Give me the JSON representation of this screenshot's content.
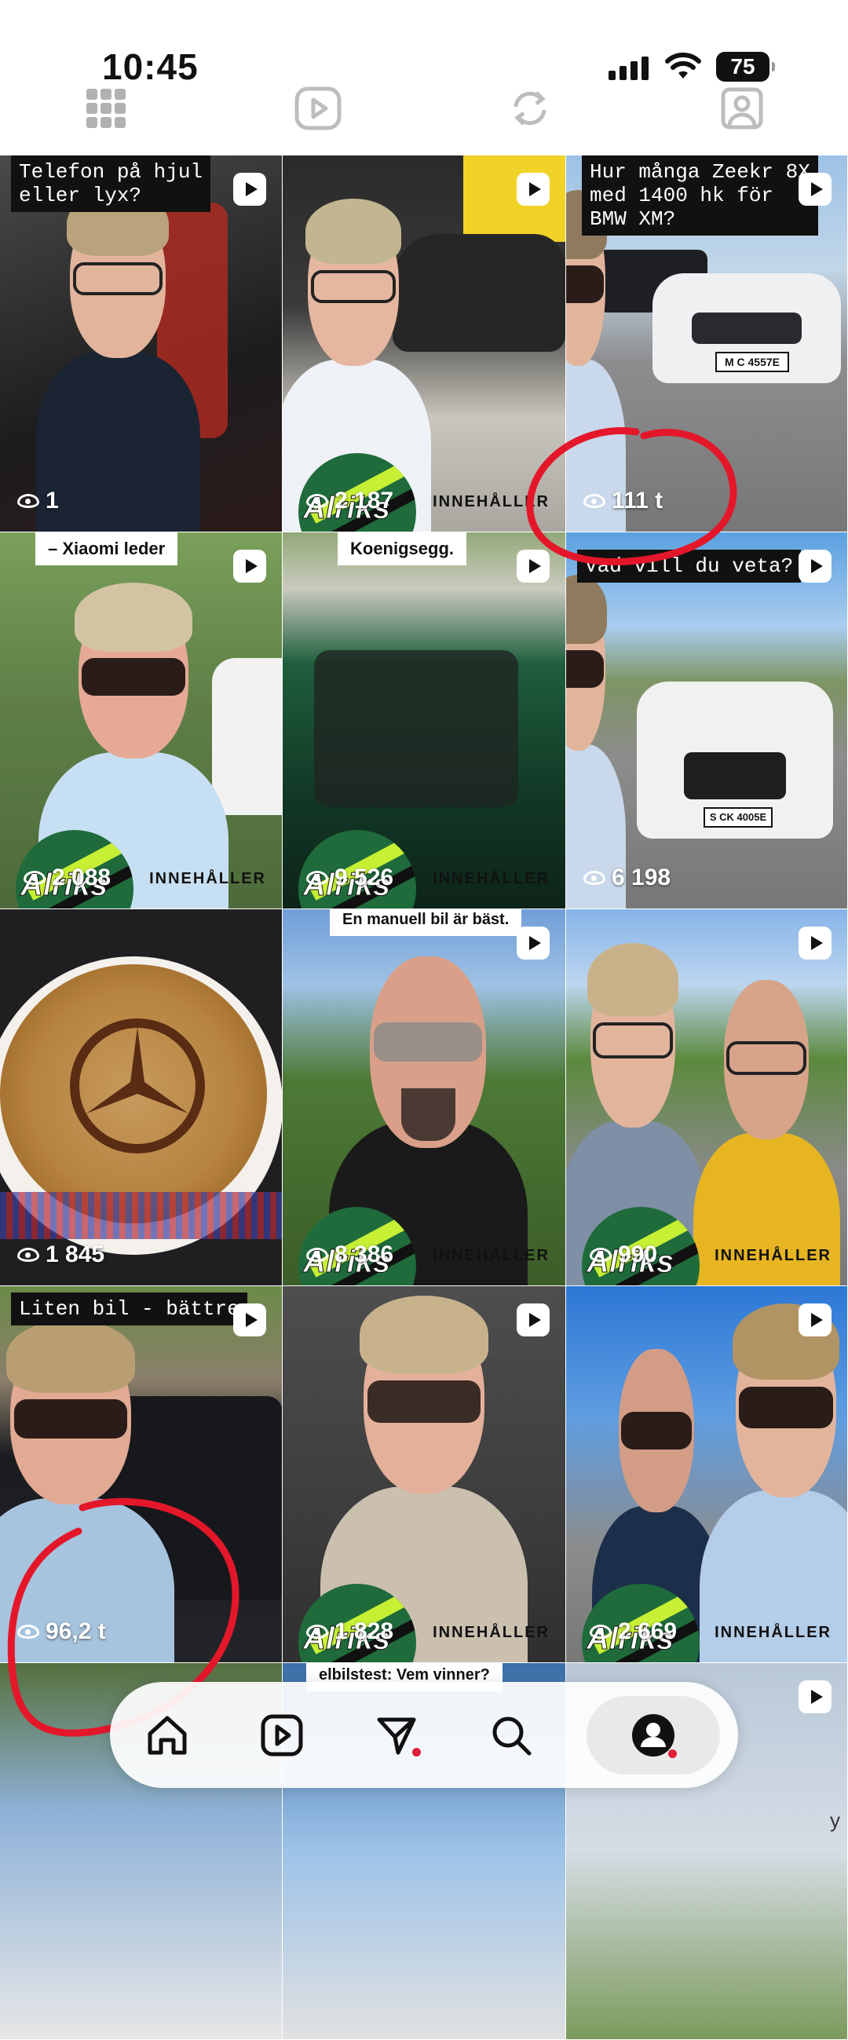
{
  "status_bar": {
    "time": "10:45",
    "battery": "75"
  },
  "tiles": [
    {
      "caption": "Telefon på hjul\neller lyx?",
      "caption_style": "dark",
      "views": "1",
      "has_logo": false,
      "ad_label": ""
    },
    {
      "caption": "",
      "caption_style": "",
      "views": "2 187",
      "has_logo": true,
      "logo_text": "Alriks",
      "ad_label": "INNEHÅLLER"
    },
    {
      "caption": "Hur många Zeekr 8X\nmed 1400 hk för\nBMW XM?",
      "caption_style": "dark",
      "views": "111 t",
      "has_logo": false,
      "ad_label": ""
    },
    {
      "caption": "– Xiaomi leder",
      "caption_style": "light",
      "views": "2 088",
      "has_logo": true,
      "logo_text": "Alriks",
      "ad_label": "INNEHÅLLER"
    },
    {
      "caption": "Koenigsegg.",
      "caption_style": "light",
      "views": "9 526",
      "has_logo": true,
      "logo_text": "Alriks",
      "ad_label": "INNEHÅLLER"
    },
    {
      "caption": "Vad vill du veta?",
      "caption_style": "dark",
      "views": "6 198",
      "has_logo": false,
      "ad_label": ""
    },
    {
      "caption": "",
      "caption_style": "",
      "views": "1 845",
      "has_logo": false,
      "ad_label": ""
    },
    {
      "caption": "En manuell bil är bäst.",
      "caption_style": "light",
      "views": "8 386",
      "has_logo": true,
      "logo_text": "Alriks",
      "ad_label": "INNEHÅLLER"
    },
    {
      "caption": "",
      "caption_style": "",
      "views": "990",
      "has_logo": true,
      "logo_text": "Alriks",
      "ad_label": "INNEHÅLLER"
    },
    {
      "caption": "Liten bil - bättre",
      "caption_style": "dark",
      "views": "96,2 t",
      "has_logo": false,
      "ad_label": ""
    },
    {
      "caption": "",
      "caption_style": "",
      "views": "1 828",
      "has_logo": true,
      "logo_text": "Alriks",
      "ad_label": "INNEHÅLLER"
    },
    {
      "caption": "",
      "caption_style": "",
      "views": "2 669",
      "has_logo": true,
      "logo_text": "Alriks",
      "ad_label": "INNEHÅLLER"
    },
    {
      "caption": "",
      "caption_style": "",
      "views": "",
      "has_logo": false,
      "ad_label": ""
    },
    {
      "caption": "elbilstest: Vem vinner?",
      "caption_style": "light",
      "views": "",
      "has_logo": false,
      "ad_label": ""
    },
    {
      "caption": "",
      "caption_style": "",
      "views": "",
      "has_logo": false,
      "ad_label": ""
    }
  ],
  "license_plates": {
    "bmw": "M C 4557E",
    "mercedes": "S CK 4005E"
  },
  "bottom_nav": {
    "items": [
      "home-icon",
      "reels-icon",
      "direct-messages-icon",
      "search-icon",
      "profile-icon"
    ],
    "active": "profile-icon"
  },
  "corner_glyph": "y",
  "colors": {
    "annotation_red": "#e4172a",
    "notification_red": "#e21d37",
    "logo_green": "#1f6b3b",
    "logo_lime": "#c7ef34"
  }
}
